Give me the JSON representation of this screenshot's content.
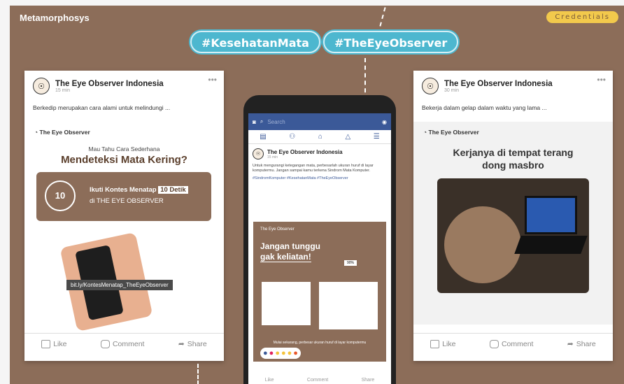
{
  "brand": "Metamorphosys",
  "credentials": "Credentials",
  "tags": [
    "#KesehatanMata",
    "#TheEyeObserver"
  ],
  "left_post": {
    "name": "The Eye Observer Indonesia",
    "time": "15 min",
    "desc": "Berkedip merupakan cara alami untuk melindungi ...",
    "logo": "The Eye Observer",
    "sub": "Mau Tahu Cara Sederhana",
    "headline": "Mendeteksi Mata Kering?",
    "promo_a": "Ikuti Kontes Menatap",
    "promo_badge": "10 Detik",
    "promo_b": "di THE EYE OBSERVER",
    "timer": "10",
    "link": "bit.ly/KontesMenatap_TheEyeObserver"
  },
  "right_post": {
    "name": "The Eye Observer Indonesia",
    "time": "30 min",
    "desc": "Bekerja dalam gelap dalam waktu yang lama ...",
    "logo": "The Eye Observer",
    "headline_1": "Kerjanya di tempat terang",
    "headline_2": "dong masbro"
  },
  "actions": {
    "like": "Like",
    "comment": "Comment",
    "share": "Share"
  },
  "phone": {
    "search": "Search",
    "name": "The Eye Observer Indonesia",
    "time": "15 min",
    "text": "Untuk mengurangi ketegangan mata, perbesarlah ukuran huruf di layar komputermu. Jangan sampai kamu terkena Sindrom Mata Komputer.",
    "hashtags": "#SindromKomputer #KesehatanMata #TheEyeObserver",
    "logo": "The Eye Observer",
    "headline_1": "Jangan tunggu",
    "headline_2": "gak keliatan!",
    "zoom": "90%",
    "footer": "Mulai sekarang, perbesar ukuran huruf di layar komputermu",
    "like": "Like",
    "comment": "Comment",
    "share": "Share"
  }
}
